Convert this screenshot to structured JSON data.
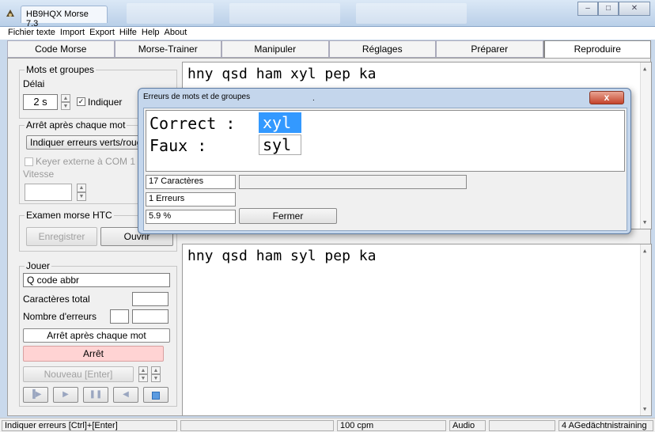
{
  "window": {
    "title": "HB9HQX Morse 7.3",
    "icon": "morse-app-icon",
    "minimize": "–",
    "maximize": "□",
    "close": "✕"
  },
  "menu": [
    "Fichier texte",
    "Import",
    "Export",
    "Hilfe",
    "Help",
    "About"
  ],
  "tabs": [
    "Code Morse",
    "Morse-Trainer",
    "Manipuler",
    "Réglages",
    "Préparer",
    "Reproduire"
  ],
  "active_tab": "Reproduire",
  "left": {
    "group1": {
      "title": "Mots et groupes",
      "delay_label": "Délai",
      "delay_value": "2 s",
      "show_check_label": "Indiquer"
    },
    "group2": {
      "title": "Arrêt après chaque mot",
      "button": "Indiquer erreurs verts/rouges",
      "keyer_label": "Keyer externe à COM 1",
      "speed_label": "Vitesse",
      "speed_value": ""
    },
    "group3": {
      "title": "Examen morse HTC",
      "save": "Enregistrer",
      "open": "Ouvrir"
    },
    "group4": {
      "title": "Jouer",
      "mode_value": "Q code abbr",
      "total_label": "Caractères total",
      "total_value": "",
      "errors_label": "Nombre d'erreurs",
      "errors_value1": "",
      "errors_value2": "",
      "stop_button": "Arrêt après chaque mot",
      "stop2_button": "Arrêt",
      "new_button": "Nouveau  [Enter]"
    }
  },
  "top_text": "hny qsd ham xyl pep ka",
  "bottom_text": "hny qsd ham syl pep ka",
  "dialog": {
    "title": "Erreurs de mots et de groupes",
    "dot": ".",
    "close": "x",
    "correct_label": "Correct :",
    "correct_value": "xyl",
    "wrong_label": "Faux    :",
    "wrong_value": "syl",
    "chars": "17 Caractères",
    "errors": "1 Erreurs",
    "percent": "5.9 %",
    "close_button": "Fermer"
  },
  "status": {
    "hint": "Indiquer erreurs  [Ctrl]+[Enter]",
    "speed": "100 cpm",
    "audio": "Audio",
    "mode": "4 AGedächtnistraining"
  }
}
